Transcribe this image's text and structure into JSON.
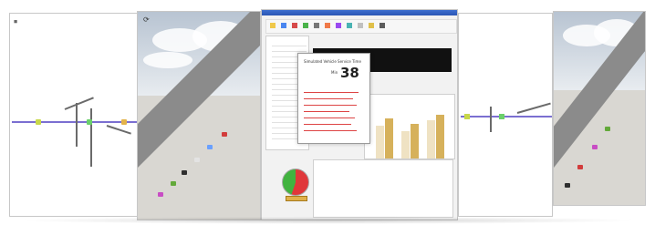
{
  "popup": {
    "title": "Simulated Vehicle Service Time",
    "value_label": "Min",
    "value": "38"
  },
  "icons": {
    "refresh": "refresh-icon",
    "close": "close-icon"
  },
  "colors": {
    "titlebar": "#2b56b4",
    "road": "#7b7b7b",
    "bar_gold": "#d6b15b",
    "bar_light": "#efe2c3",
    "gauge_green": "#41b33f",
    "gauge_red": "#e0373a"
  }
}
